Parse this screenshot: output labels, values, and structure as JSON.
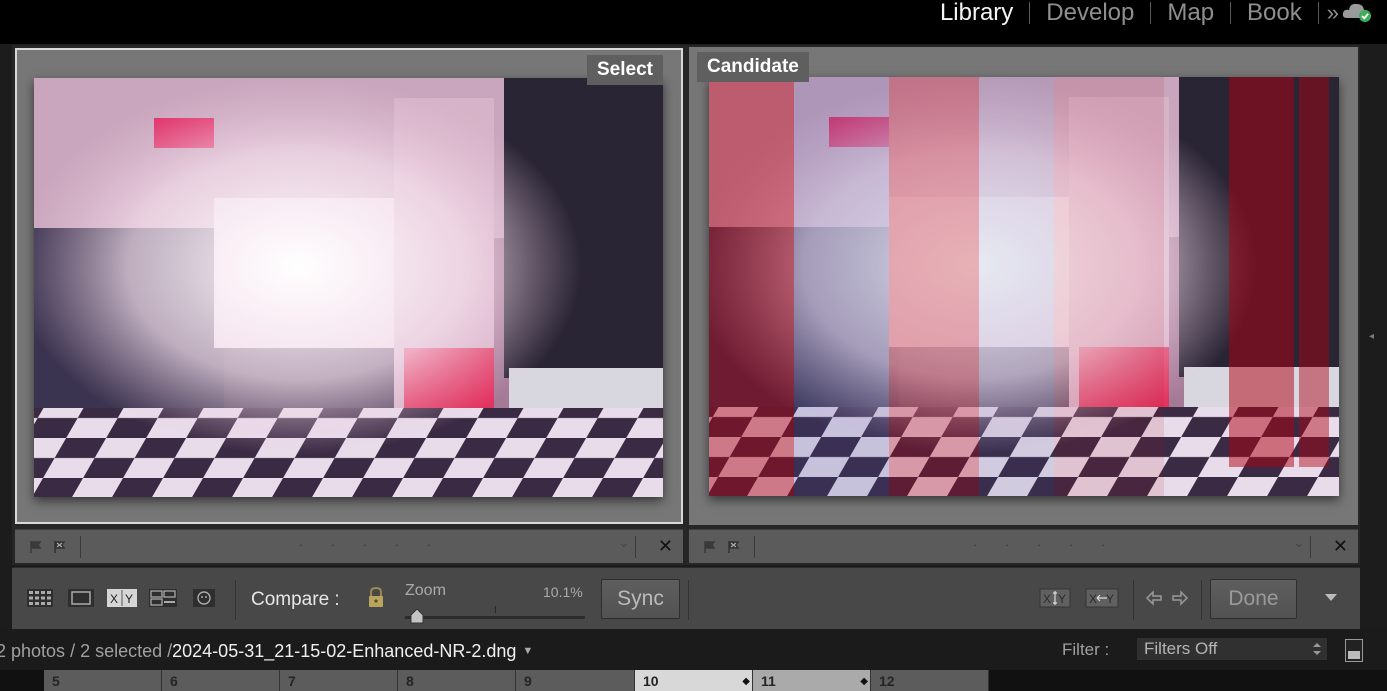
{
  "modules": [
    "Library",
    "Develop",
    "Map",
    "Book"
  ],
  "active_module": "Library",
  "more_label": "»",
  "left_pane": {
    "label": "Select"
  },
  "right_pane": {
    "label": "Candidate"
  },
  "flagbar": {
    "dots": "· · · · ·",
    "close": "✕"
  },
  "toolbar": {
    "compare_label": "Compare :",
    "zoom_label": "Zoom",
    "zoom_value": "10.1%",
    "zoom_level_fraction": 0.06,
    "sync_label": "Sync",
    "done_label": "Done"
  },
  "filmstrip_header": {
    "count": "2 photos",
    "selected": "/ 2 selected /",
    "filename": "2024-05-31_21-15-02-Enhanced-NR-2.dng",
    "filter_label": "Filter :",
    "filter_value": "Filters Off"
  },
  "filmstrip_numbers": [
    "5",
    "6",
    "7",
    "8",
    "9",
    "10",
    "11",
    "12"
  ],
  "colors": {
    "accent_green": "#4caf50",
    "pane_bg": "#777777",
    "toolbar_bg": "#484848"
  }
}
